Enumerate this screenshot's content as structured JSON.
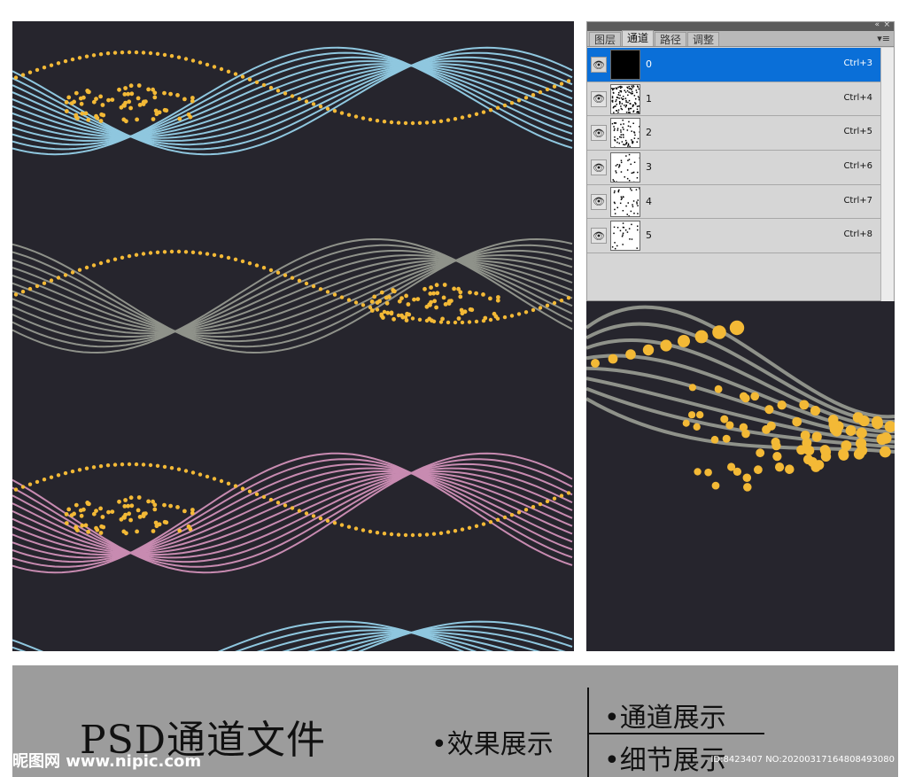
{
  "colors": {
    "background": "#26252d",
    "blue_lines": "#8fc7df",
    "gray_lines": "#8f928a",
    "pink_lines": "#c88bb1",
    "dots": "#f3b936",
    "panel_selected": "#0a6fd8",
    "banner": "#9c9c9c"
  },
  "channels_panel": {
    "collapse_icon": "«",
    "close_icon": "×",
    "menu_icon": "▾≡",
    "tabs": [
      {
        "label": "图层",
        "active": false
      },
      {
        "label": "通道",
        "active": true
      },
      {
        "label": "路径",
        "active": false
      },
      {
        "label": "调整",
        "active": false
      }
    ],
    "rows": [
      {
        "name": "0",
        "shortcut": "Ctrl+3",
        "selected": true
      },
      {
        "name": "1",
        "shortcut": "Ctrl+4",
        "selected": false
      },
      {
        "name": "2",
        "shortcut": "Ctrl+5",
        "selected": false
      },
      {
        "name": "3",
        "shortcut": "Ctrl+6",
        "selected": false
      },
      {
        "name": "4",
        "shortcut": "Ctrl+7",
        "selected": false
      },
      {
        "name": "5",
        "shortcut": "Ctrl+8",
        "selected": false
      }
    ],
    "eye_icon": "👁"
  },
  "banner": {
    "title": "PSD通道文件",
    "effect": "•效果展示",
    "channel": "•通道展示",
    "detail": "•细节展示",
    "watermark_logo": "昵图网 www.nipic.com",
    "watermark_id": "ID:8423407 NO:20200317164808493080"
  }
}
